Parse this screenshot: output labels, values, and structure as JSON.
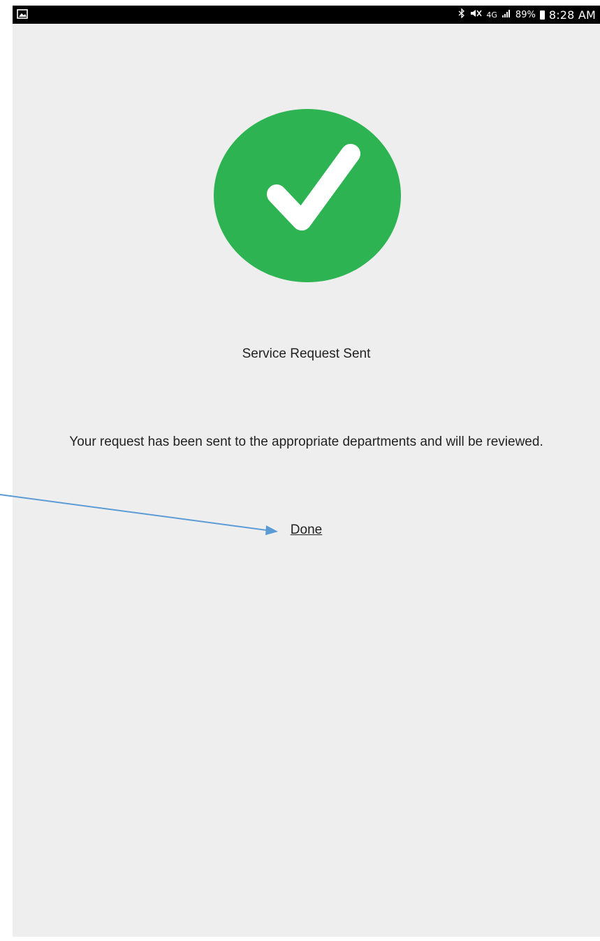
{
  "status_bar": {
    "battery_percent": "89%",
    "time": "8:28 AM",
    "network": "4G",
    "icons": [
      "gallery-icon",
      "bluetooth-icon",
      "mute-icon",
      "signal-icon",
      "battery-icon"
    ]
  },
  "confirmation": {
    "icon": "checkmark-icon",
    "accent_color": "#2db352",
    "title": "Service Request Sent",
    "message": "Your request has been sent to the appropriate departments and will be reviewed.",
    "done_label": "Done"
  },
  "annotation": {
    "arrow_color": "#5b9bd5"
  }
}
